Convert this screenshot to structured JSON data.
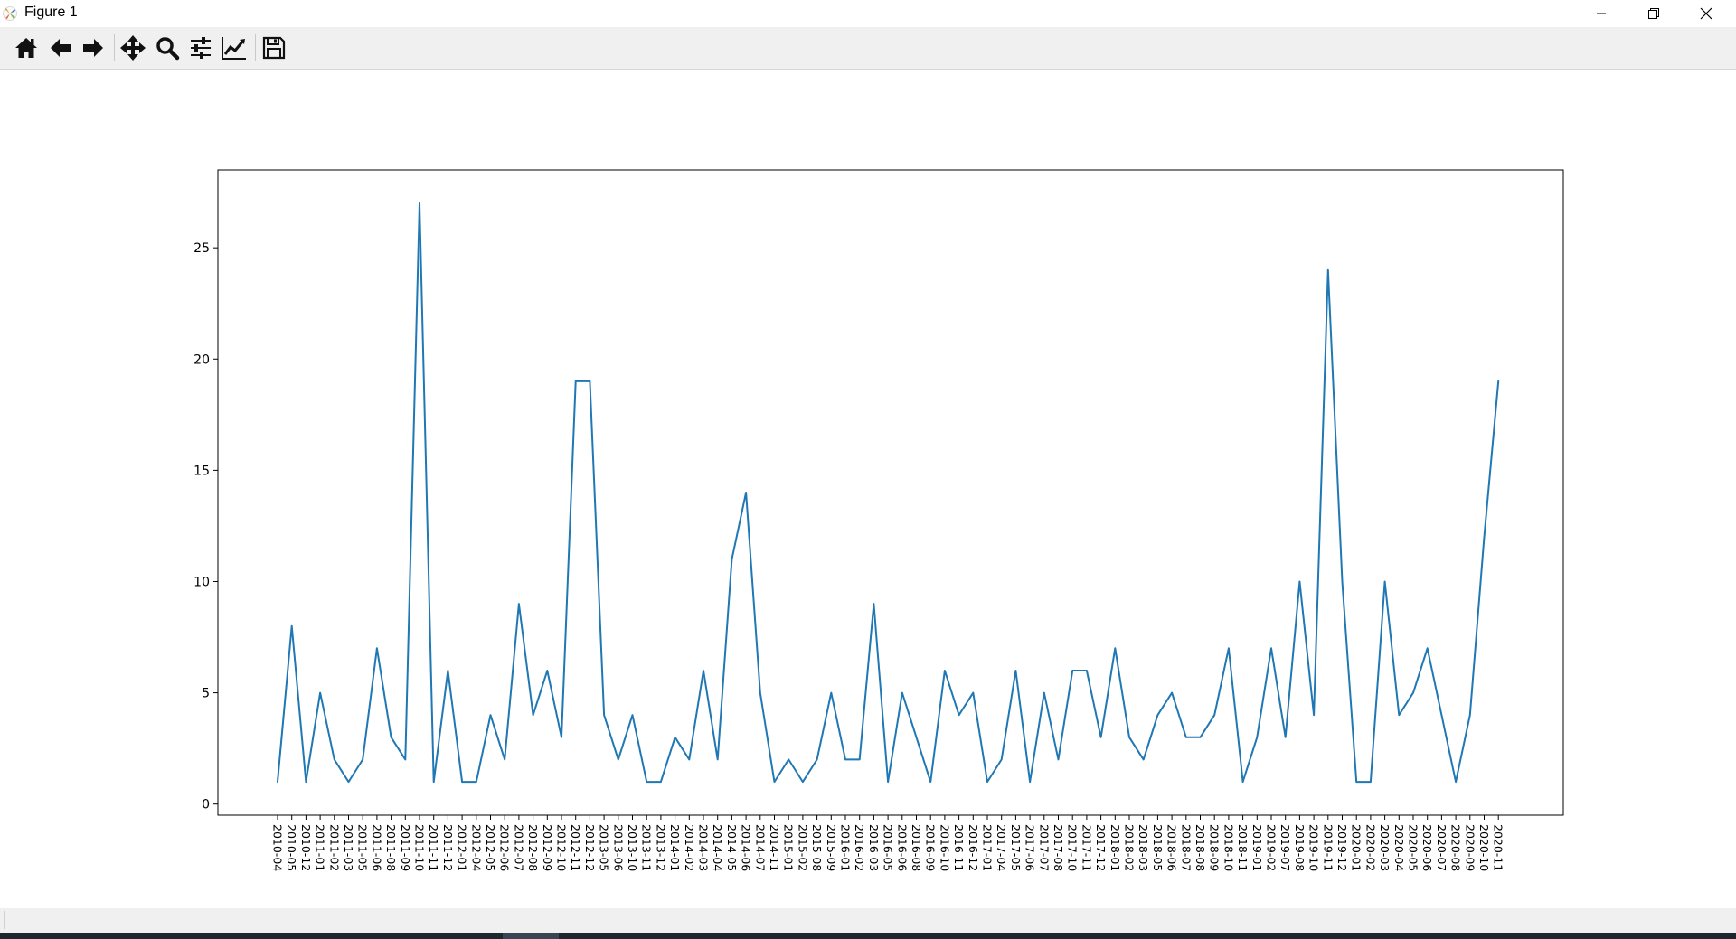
{
  "window": {
    "title": "Figure 1"
  },
  "toolbar": {
    "buttons": [
      {
        "name": "home-icon",
        "icon": "home"
      },
      {
        "name": "back-arrow-icon",
        "icon": "arrow-left"
      },
      {
        "name": "forward-arrow-icon",
        "icon": "arrow-right"
      },
      {
        "name": "pan-icon",
        "icon": "move"
      },
      {
        "name": "zoom-icon",
        "icon": "magnifier"
      },
      {
        "name": "configure-subplots-icon",
        "icon": "sliders"
      },
      {
        "name": "edit-axis-icon",
        "icon": "line-chart"
      },
      {
        "name": "save-icon",
        "icon": "floppy-disk"
      }
    ]
  },
  "chart_data": {
    "type": "line",
    "color": "#1f77b4",
    "grid": false,
    "ylim": [
      -0.5,
      28.5
    ],
    "yticks": [
      0,
      5,
      10,
      15,
      20,
      25
    ],
    "x": [
      "2010-04",
      "2010-05",
      "2010-12",
      "2011-01",
      "2011-02",
      "2011-03",
      "2011-05",
      "2011-06",
      "2011-08",
      "2011-09",
      "2011-10",
      "2011-11",
      "2011-12",
      "2012-01",
      "2012-04",
      "2012-05",
      "2012-06",
      "2012-07",
      "2012-08",
      "2012-09",
      "2012-10",
      "2012-11",
      "2012-12",
      "2013-05",
      "2013-06",
      "2013-10",
      "2013-11",
      "2013-12",
      "2014-01",
      "2014-02",
      "2014-03",
      "2014-04",
      "2014-05",
      "2014-06",
      "2014-07",
      "2014-11",
      "2015-01",
      "2015-02",
      "2015-08",
      "2015-09",
      "2016-01",
      "2016-02",
      "2016-03",
      "2016-05",
      "2016-06",
      "2016-08",
      "2016-09",
      "2016-10",
      "2016-11",
      "2016-12",
      "2017-01",
      "2017-04",
      "2017-05",
      "2017-06",
      "2017-07",
      "2017-08",
      "2017-10",
      "2017-11",
      "2017-12",
      "2018-01",
      "2018-02",
      "2018-03",
      "2018-05",
      "2018-06",
      "2018-07",
      "2018-08",
      "2018-09",
      "2018-10",
      "2018-11",
      "2019-01",
      "2019-02",
      "2019-07",
      "2019-08",
      "2019-10",
      "2019-11",
      "2019-12",
      "2020-01",
      "2020-02",
      "2020-03",
      "2020-04",
      "2020-05",
      "2020-06",
      "2020-07",
      "2020-08",
      "2020-09",
      "2020-10",
      "2020-11"
    ],
    "y": [
      1,
      8,
      1,
      5,
      2,
      1,
      2,
      7,
      3,
      2,
      27,
      1,
      6,
      1,
      1,
      4,
      2,
      9,
      4,
      6,
      3,
      19,
      19,
      4,
      2,
      4,
      1,
      1,
      3,
      2,
      6,
      2,
      11,
      14,
      5,
      1,
      2,
      1,
      2,
      5,
      2,
      2,
      9,
      1,
      5,
      3,
      1,
      6,
      4,
      5,
      1,
      2,
      6,
      1,
      5,
      2,
      6,
      6,
      3,
      7,
      3,
      2,
      4,
      5,
      3,
      3,
      4,
      7,
      1,
      3,
      7,
      3,
      10,
      4,
      24,
      10,
      1,
      1,
      10,
      4,
      5,
      7,
      4,
      1,
      4,
      12,
      19
    ]
  }
}
